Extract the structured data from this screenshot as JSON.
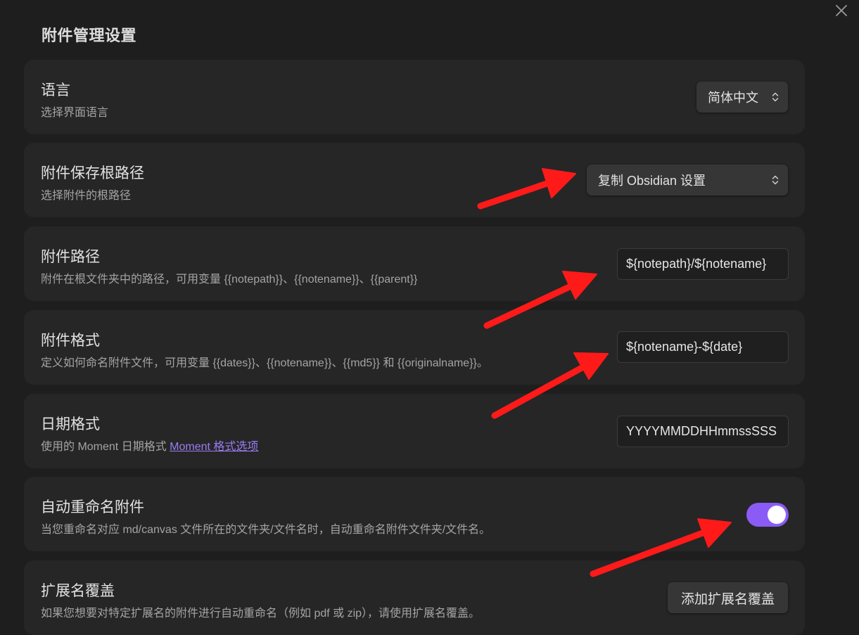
{
  "dialog": {
    "title": "附件管理设置",
    "close_icon": "close-icon"
  },
  "settings": {
    "language": {
      "name": "语言",
      "desc": "选择界面语言",
      "value": "简体中文"
    },
    "root_path": {
      "name": "附件保存根路径",
      "desc": "选择附件的根路径",
      "value": "复制 Obsidian 设置"
    },
    "attach_path": {
      "name": "附件路径",
      "desc": "附件在根文件夹中的路径，可用变量 {{notepath}}、{{notename}}、{{parent}}",
      "value": "${notepath}/${notename}"
    },
    "attach_format": {
      "name": "附件格式",
      "desc": "定义如何命名附件文件，可用变量 {{dates}}、{{notename}}、{{md5}} 和 {{originalname}}。",
      "value": "${notename}-${date}"
    },
    "date_format": {
      "name": "日期格式",
      "desc_prefix": "使用的 Moment 日期格式 ",
      "desc_link": "Moment 格式选项",
      "value": "YYYYMMDDHHmmssSSS"
    },
    "auto_rename": {
      "name": "自动重命名附件",
      "desc": "当您重命名对应 md/canvas 文件所在的文件夹/文件名时，自动重命名附件文件夹/文件名。",
      "enabled": true
    },
    "ext_override": {
      "name": "扩展名覆盖",
      "desc": "如果您想要对特定扩展名的附件进行自动重命名（例如 pdf 或 zip），请使用扩展名覆盖。",
      "button_label": "添加扩展名覆盖"
    }
  },
  "colors": {
    "background": "#1e1e1e",
    "card": "#262626",
    "accent": "#8a5cf5",
    "link": "#9b7cf5",
    "annotation_arrow": "#ff1a1a"
  }
}
